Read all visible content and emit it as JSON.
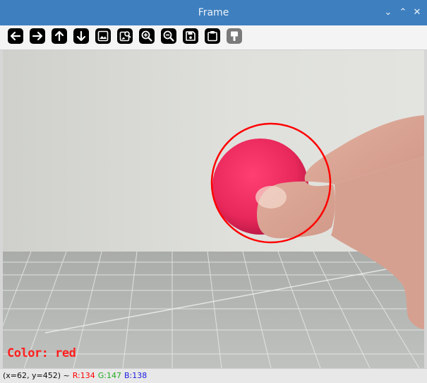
{
  "window": {
    "title": "Frame",
    "controls": {
      "minimize": "⌄",
      "maximize": "⌃",
      "close": "✕"
    }
  },
  "toolbar": {
    "buttons": [
      {
        "name": "pan-left",
        "icon": "arrow-left-icon"
      },
      {
        "name": "pan-right",
        "icon": "arrow-right-icon"
      },
      {
        "name": "pan-up",
        "icon": "arrow-up-icon"
      },
      {
        "name": "pan-down",
        "icon": "arrow-down-icon"
      },
      {
        "name": "zoom-fit",
        "icon": "image-icon"
      },
      {
        "name": "zoom-original",
        "icon": "image-zoom-icon"
      },
      {
        "name": "zoom-in",
        "icon": "zoom-in-icon"
      },
      {
        "name": "zoom-out",
        "icon": "zoom-out-icon"
      },
      {
        "name": "save",
        "icon": "save-icon"
      },
      {
        "name": "copy",
        "icon": "clipboard-icon"
      },
      {
        "name": "properties",
        "icon": "paint-brush-icon"
      }
    ]
  },
  "overlay": {
    "color_label": "Color: red"
  },
  "status": {
    "coords": "(x=62, y=452) ~",
    "r": "R:134",
    "g": "G:147",
    "b": "B:138"
  },
  "colors": {
    "titlebar": "#3e7fbf",
    "ball": "#e8285a",
    "detection_circle": "#ff0000",
    "r_text": "#ff0000",
    "g_text": "#22aa22",
    "b_text": "#1a1ae0"
  }
}
